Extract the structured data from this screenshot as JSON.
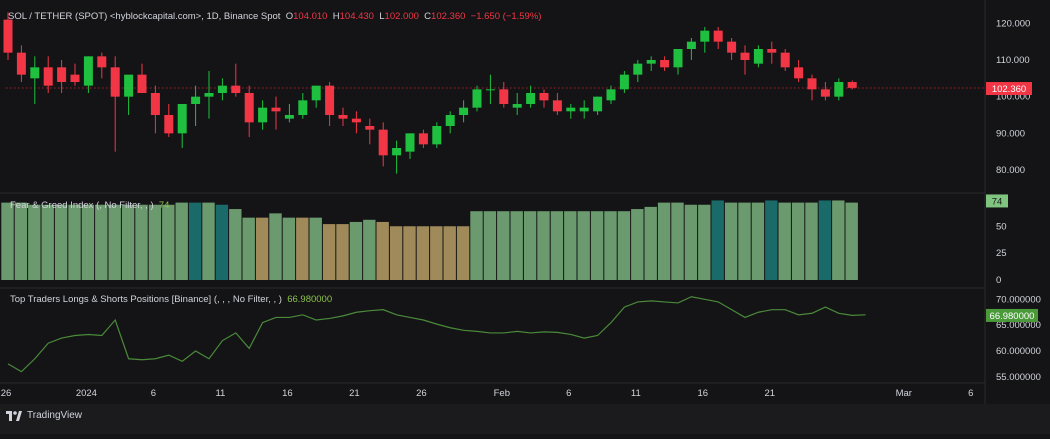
{
  "header": {
    "symbol": "SOL / TETHER (SPOT) <hyblockcapital.com>, 1D, Binance Spot",
    "open_label": "O",
    "open": "104.010",
    "high_label": "H",
    "high": "104.430",
    "low_label": "L",
    "low": "102.000",
    "close_label": "C",
    "close": "102.360",
    "change": "−1.650 (−1.59%)"
  },
  "panes": {
    "fng_title": "Fear & Greed Index (, No Filter, , )",
    "fng_value": "74",
    "traders_title": "Top Traders Longs & Shorts Positions [Binance] (, , , No Filter, , )",
    "traders_value": "66.980000"
  },
  "footer": {
    "brand": "TradingView"
  },
  "colors": {
    "up": "#26a69a",
    "up_body": "#1fbf3f",
    "down": "#f23645",
    "fng_greed": "#6b9a6e",
    "fng_extreme": "#1a6a6a",
    "fng_neutral": "#a08a5a",
    "traders_line": "#4a8a3a",
    "bg": "#141416",
    "grid": "#26262a"
  },
  "chart_data": [
    {
      "type": "candlestick",
      "title": "SOL / TETHER (SPOT) <hyblockcapital.com>, 1D, Binance Spot",
      "price_axis_ticks": [
        "120.000",
        "110.000",
        "100.000",
        "90.000",
        "80.000"
      ],
      "ylim": [
        74,
        125
      ],
      "last_price": "102.360",
      "candles": [
        {
          "o": 121,
          "h": 123,
          "l": 110,
          "c": 112
        },
        {
          "o": 112,
          "h": 114,
          "l": 104,
          "c": 106
        },
        {
          "o": 105,
          "h": 111,
          "l": 98,
          "c": 108
        },
        {
          "o": 108,
          "h": 111,
          "l": 101,
          "c": 103
        },
        {
          "o": 108,
          "h": 110,
          "l": 101,
          "c": 104
        },
        {
          "o": 106,
          "h": 109,
          "l": 103,
          "c": 104
        },
        {
          "o": 103,
          "h": 111,
          "l": 101,
          "c": 111
        },
        {
          "o": 111,
          "h": 112,
          "l": 105,
          "c": 108
        },
        {
          "o": 108,
          "h": 111,
          "l": 85,
          "c": 100
        },
        {
          "o": 100,
          "h": 105,
          "l": 95,
          "c": 106
        },
        {
          "o": 106,
          "h": 109,
          "l": 102,
          "c": 101
        },
        {
          "o": 101,
          "h": 103,
          "l": 90,
          "c": 95
        },
        {
          "o": 95,
          "h": 98,
          "l": 89,
          "c": 90
        },
        {
          "o": 90,
          "h": 96,
          "l": 86,
          "c": 98
        },
        {
          "o": 98,
          "h": 103,
          "l": 92,
          "c": 100
        },
        {
          "o": 100,
          "h": 107,
          "l": 94,
          "c": 101
        },
        {
          "o": 101,
          "h": 105,
          "l": 99,
          "c": 103
        },
        {
          "o": 103,
          "h": 109,
          "l": 100,
          "c": 101
        },
        {
          "o": 101,
          "h": 103,
          "l": 89,
          "c": 93
        },
        {
          "o": 93,
          "h": 99,
          "l": 91,
          "c": 97
        },
        {
          "o": 97,
          "h": 100,
          "l": 91,
          "c": 96
        },
        {
          "o": 94,
          "h": 98,
          "l": 93,
          "c": 95
        },
        {
          "o": 95,
          "h": 101,
          "l": 94,
          "c": 99
        },
        {
          "o": 99,
          "h": 103,
          "l": 97,
          "c": 103
        },
        {
          "o": 103,
          "h": 104,
          "l": 92,
          "c": 95
        },
        {
          "o": 95,
          "h": 97,
          "l": 92,
          "c": 94
        },
        {
          "o": 94,
          "h": 96,
          "l": 90,
          "c": 93
        },
        {
          "o": 92,
          "h": 94,
          "l": 87,
          "c": 91
        },
        {
          "o": 91,
          "h": 93,
          "l": 81,
          "c": 84
        },
        {
          "o": 84,
          "h": 88,
          "l": 79,
          "c": 86
        },
        {
          "o": 85,
          "h": 90,
          "l": 83,
          "c": 90
        },
        {
          "o": 90,
          "h": 91,
          "l": 86,
          "c": 87
        },
        {
          "o": 87,
          "h": 93,
          "l": 86,
          "c": 92
        },
        {
          "o": 92,
          "h": 96,
          "l": 90,
          "c": 95
        },
        {
          "o": 95,
          "h": 99,
          "l": 93,
          "c": 97
        },
        {
          "o": 97,
          "h": 103,
          "l": 96,
          "c": 102
        },
        {
          "o": 102,
          "h": 106,
          "l": 98,
          "c": 102
        },
        {
          "o": 102,
          "h": 104,
          "l": 97,
          "c": 98
        },
        {
          "o": 97,
          "h": 101,
          "l": 95,
          "c": 98
        },
        {
          "o": 98,
          "h": 103,
          "l": 97,
          "c": 101
        },
        {
          "o": 101,
          "h": 102,
          "l": 97,
          "c": 99
        },
        {
          "o": 99,
          "h": 101,
          "l": 95,
          "c": 96
        },
        {
          "o": 96,
          "h": 98,
          "l": 94,
          "c": 97
        },
        {
          "o": 96,
          "h": 99,
          "l": 94,
          "c": 97
        },
        {
          "o": 96,
          "h": 100,
          "l": 95,
          "c": 100
        },
        {
          "o": 99,
          "h": 103,
          "l": 98,
          "c": 102
        },
        {
          "o": 102,
          "h": 107,
          "l": 101,
          "c": 106
        },
        {
          "o": 106,
          "h": 110,
          "l": 104,
          "c": 109
        },
        {
          "o": 109,
          "h": 111,
          "l": 107,
          "c": 110
        },
        {
          "o": 110,
          "h": 111,
          "l": 107,
          "c": 108
        },
        {
          "o": 108,
          "h": 113,
          "l": 106,
          "c": 113
        },
        {
          "o": 113,
          "h": 116,
          "l": 110,
          "c": 115
        },
        {
          "o": 115,
          "h": 119,
          "l": 112,
          "c": 118
        },
        {
          "o": 118,
          "h": 119,
          "l": 113,
          "c": 115
        },
        {
          "o": 115,
          "h": 116,
          "l": 110,
          "c": 112
        },
        {
          "o": 112,
          "h": 114,
          "l": 106,
          "c": 110
        },
        {
          "o": 109,
          "h": 114,
          "l": 108,
          "c": 113
        },
        {
          "o": 113,
          "h": 115,
          "l": 109,
          "c": 112
        },
        {
          "o": 112,
          "h": 113,
          "l": 107,
          "c": 108
        },
        {
          "o": 108,
          "h": 110,
          "l": 104,
          "c": 105
        },
        {
          "o": 105,
          "h": 106,
          "l": 99,
          "c": 102
        },
        {
          "o": 102,
          "h": 104,
          "l": 99,
          "c": 100
        },
        {
          "o": 100,
          "h": 105,
          "l": 99,
          "c": 104
        },
        {
          "o": 104,
          "h": 104.4,
          "l": 102,
          "c": 102.4
        }
      ]
    },
    {
      "type": "bar",
      "title": "Fear & Greed Index (, No Filter, , )",
      "axis_ticks": [
        "50",
        "25",
        "0"
      ],
      "ylim": [
        0,
        80
      ],
      "last_value": "74",
      "values": [
        72,
        72,
        70,
        70,
        70,
        70,
        70,
        70,
        70,
        70,
        70,
        70,
        70,
        72,
        72,
        72,
        70,
        66,
        58,
        58,
        62,
        58,
        58,
        58,
        52,
        52,
        54,
        56,
        54,
        50,
        50,
        50,
        50,
        50,
        50,
        64,
        64,
        64,
        64,
        64,
        64,
        64,
        64,
        64,
        64,
        64,
        64,
        66,
        68,
        72,
        72,
        70,
        70,
        74,
        72,
        72,
        72,
        74,
        72,
        72,
        72,
        74,
        74,
        72,
        72,
        72
      ],
      "colors_by_index": [
        "g",
        "g",
        "g",
        "g",
        "g",
        "g",
        "g",
        "g",
        "g",
        "g",
        "g",
        "g",
        "g",
        "g",
        "x",
        "g",
        "x",
        "g",
        "g",
        "n",
        "g",
        "g",
        "n",
        "g",
        "n",
        "n",
        "g",
        "g",
        "n",
        "n",
        "n",
        "n",
        "n",
        "n",
        "n",
        "g",
        "g",
        "g",
        "g",
        "g",
        "g",
        "g",
        "g",
        "g",
        "g",
        "g",
        "g",
        "g",
        "g",
        "g",
        "g",
        "g",
        "g",
        "x",
        "g",
        "g",
        "g",
        "x",
        "g",
        "g",
        "g",
        "x",
        "g",
        "g",
        "g",
        "g"
      ]
    },
    {
      "type": "line",
      "title": "Top Traders Longs & Shorts Positions [Binance] (, , , No Filter, , )",
      "axis_ticks": [
        "70.000000",
        "65.000000",
        "60.000000",
        "55.000000"
      ],
      "ylim": [
        54,
        72
      ],
      "last_value": "66.980000",
      "values": [
        57.5,
        56.0,
        58.5,
        61.5,
        62.5,
        63.0,
        63.2,
        63.0,
        66.0,
        58.5,
        58.3,
        58.5,
        59.2,
        58.0,
        60.0,
        58.5,
        62.0,
        63.5,
        60.5,
        65.5,
        66.5,
        66.5,
        67.0,
        66.0,
        66.3,
        66.8,
        67.5,
        67.8,
        68.0,
        67.0,
        66.5,
        66.0,
        65.2,
        64.5,
        64.0,
        63.8,
        63.5,
        63.5,
        63.8,
        63.5,
        63.7,
        63.6,
        63.2,
        62.5,
        63.0,
        65.5,
        68.5,
        69.5,
        69.7,
        69.5,
        69.3,
        70.5,
        70.0,
        69.5,
        68.0,
        66.5,
        67.5,
        68.0,
        68.0,
        67.0,
        67.3,
        68.5,
        67.3,
        66.9,
        67.0
      ],
      "color": "#4a8a3a"
    }
  ],
  "time_axis": {
    "labels": [
      "26",
      "2024",
      "6",
      "11",
      "16",
      "21",
      "26",
      "Feb",
      "6",
      "11",
      "16",
      "21",
      "Mar",
      "6"
    ]
  }
}
